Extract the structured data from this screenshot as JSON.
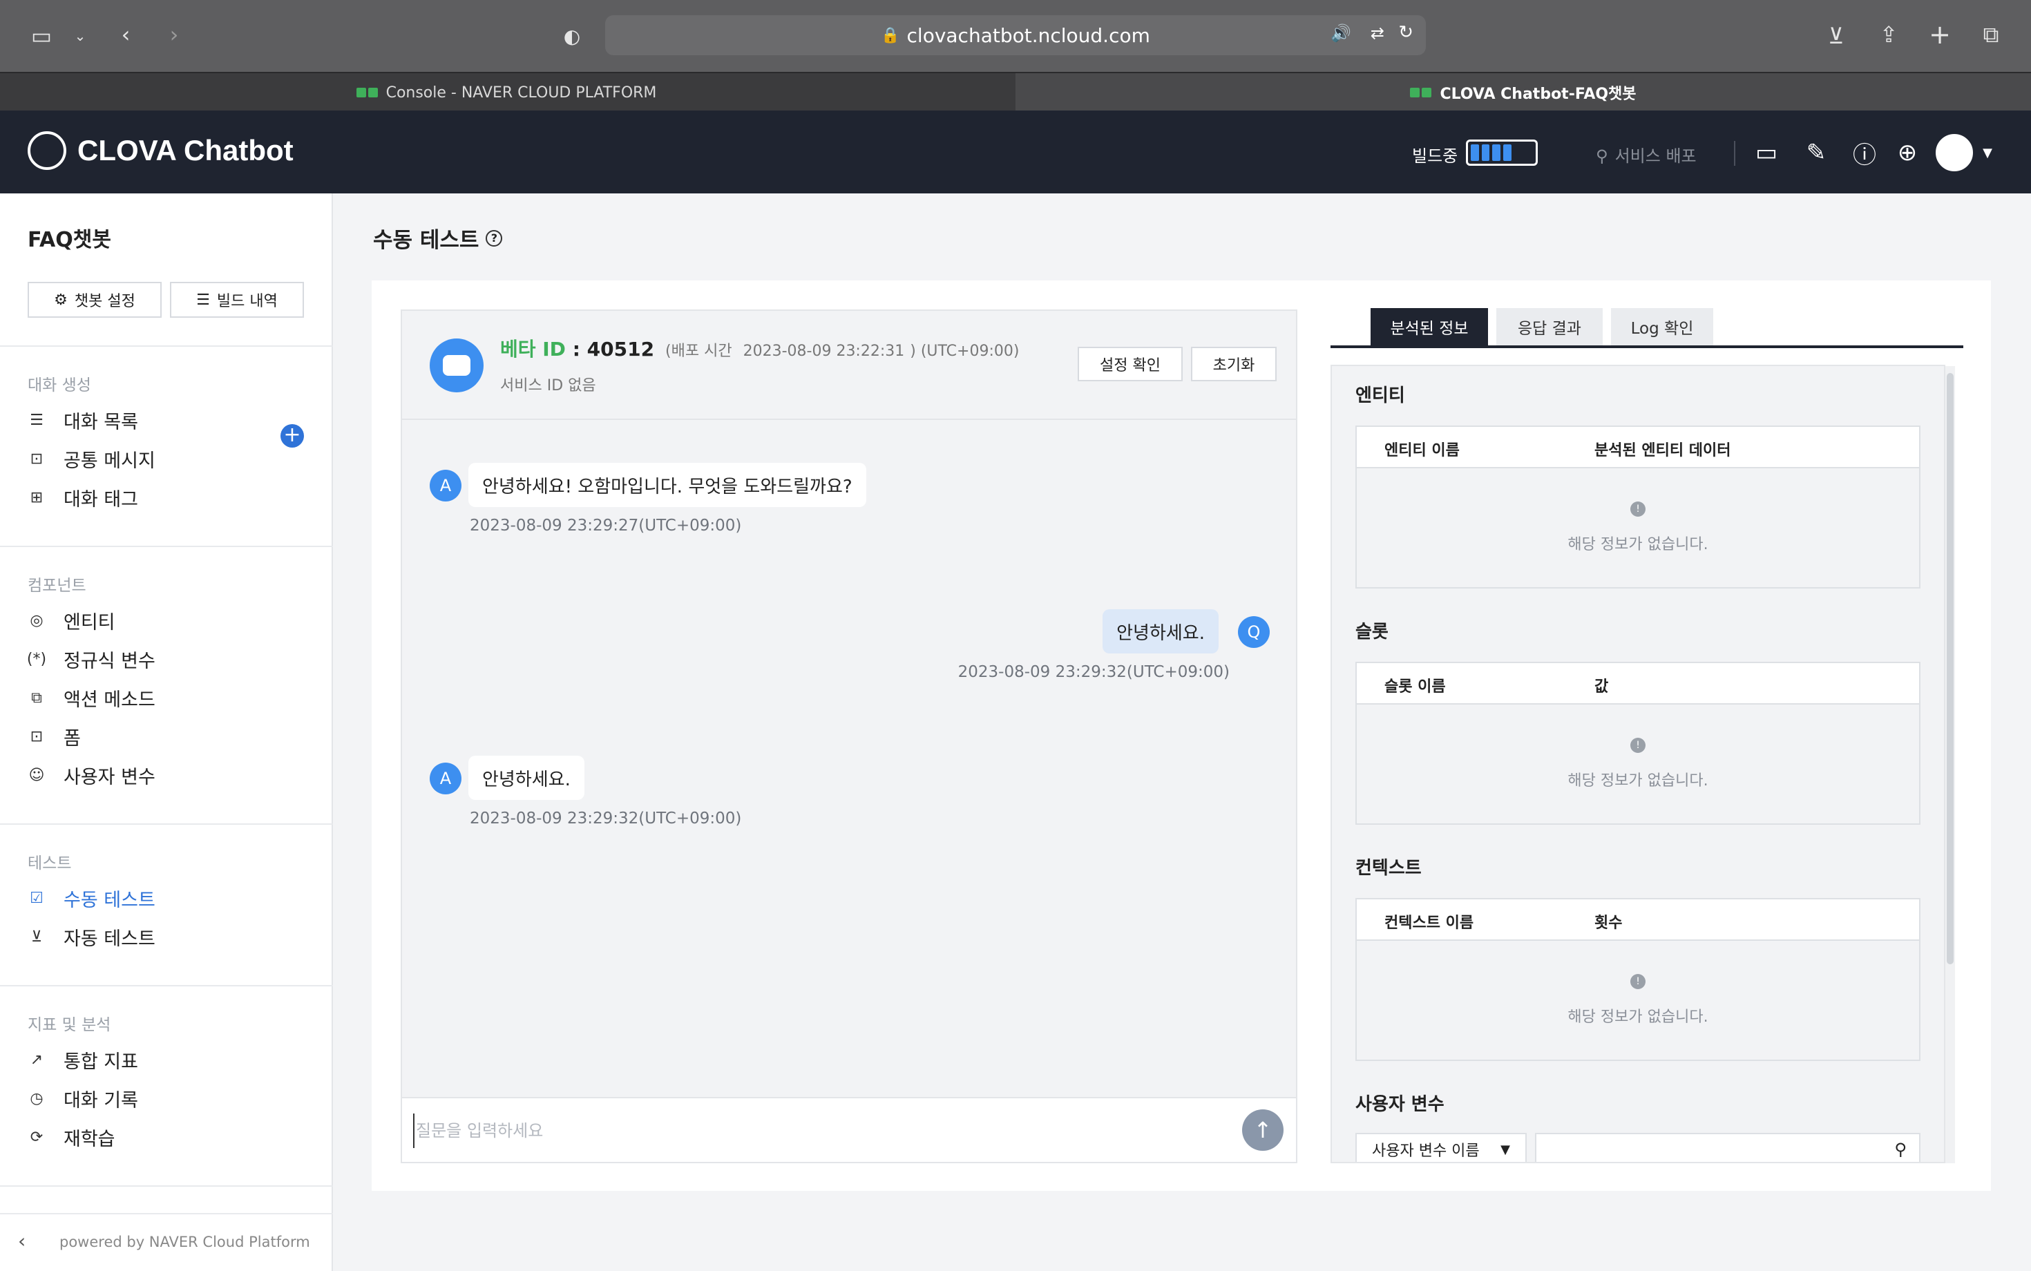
{
  "browser": {
    "url": "clovachatbot.ncloud.com",
    "tabs": [
      {
        "label": "Console - NAVER CLOUD PLATFORM",
        "active": false
      },
      {
        "label": "CLOVA Chatbot-FAQ챗봇",
        "active": true
      }
    ]
  },
  "app": {
    "brand": "CLOVA Chatbot",
    "build_status": "빌드중",
    "deploy_label": "서비스 배포"
  },
  "sidebar": {
    "title": "FAQ챗봇",
    "buttons": {
      "settings": "챗봇 설정",
      "build_history": "빌드 내역"
    },
    "sections": {
      "conversation": {
        "label": "대화 생성",
        "items": [
          "대화 목록",
          "공통 메시지",
          "대화 태그"
        ]
      },
      "components": {
        "label": "컴포넌트",
        "items": [
          "엔티티",
          "정규식 변수",
          "액션 메소드",
          "폼",
          "사용자 변수"
        ]
      },
      "test": {
        "label": "테스트",
        "items": [
          "수동 테스트",
          "자동 테스트"
        ],
        "active": "수동 테스트"
      },
      "analytics": {
        "label": "지표 및 분석",
        "items": [
          "통합 지표",
          "대화 기록",
          "재학습"
        ]
      }
    },
    "powered_by": "powered by NAVER Cloud Platform"
  },
  "page": {
    "title": "수동 테스트",
    "chat": {
      "beta_label": "베타 ID",
      "beta_id": ": 40512",
      "deploy_time_label": "(배포 시간",
      "deploy_time": "2023-08-09 23:22:31",
      "timezone": ") (UTC+09:00)",
      "service_id": "서비스 ID 없음",
      "buttons": {
        "confirm_settings": "설정 확인",
        "reset": "초기화"
      },
      "messages": [
        {
          "role": "bot",
          "avatar": "A",
          "text": "안녕하세요! 오함마입니다. 무엇을 도와드릴까요?",
          "time": "2023-08-09 23:29:27(UTC+09:00)"
        },
        {
          "role": "user",
          "avatar": "Q",
          "text": "안녕하세요.",
          "time": "2023-08-09 23:29:32(UTC+09:00)"
        },
        {
          "role": "bot",
          "avatar": "A",
          "text": "안녕하세요.",
          "time": "2023-08-09 23:29:32(UTC+09:00)"
        }
      ],
      "input_placeholder": "질문을 입력하세요"
    },
    "analysis": {
      "tabs": [
        "분석된 정보",
        "응답 결과",
        "Log 확인"
      ],
      "active_tab": "분석된 정보",
      "sections": [
        {
          "title": "엔티티",
          "columns": [
            "엔티티 이름",
            "분석된 엔티티 데이터"
          ],
          "empty": "해당 정보가 없습니다."
        },
        {
          "title": "슬롯",
          "columns": [
            "슬롯 이름",
            "값"
          ],
          "empty": "해당 정보가 없습니다."
        },
        {
          "title": "컨텍스트",
          "columns": [
            "컨텍스트 이름",
            "횟수"
          ],
          "empty": "해당 정보가 없습니다."
        }
      ],
      "user_vars": {
        "title": "사용자 변수",
        "select": "사용자 변수 이름"
      }
    }
  },
  "colors": {
    "accent": "#2f73d8",
    "beta_green": "#3fb05a",
    "header": "#1f2430"
  }
}
